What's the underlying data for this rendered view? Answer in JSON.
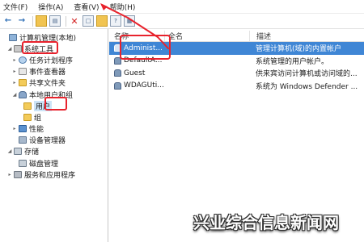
{
  "menu": {
    "items": [
      "文件(F)",
      "操作(A)",
      "查看(V)",
      "帮助(H)"
    ]
  },
  "tree": {
    "rows": [
      {
        "label": "计算机管理(本地)",
        "icon": "computer-icon"
      },
      {
        "label": "系统工具",
        "icon": "tools-icon"
      },
      {
        "label": "任务计划程序",
        "icon": "clock-icon"
      },
      {
        "label": "事件查看器",
        "icon": "event-log-icon"
      },
      {
        "label": "共享文件夹",
        "icon": "shared-folder-icon"
      },
      {
        "label": "本地用户和组",
        "icon": "users-icon"
      },
      {
        "label": "用户",
        "icon": "folder-icon"
      },
      {
        "label": "组",
        "icon": "folder-icon"
      },
      {
        "label": "性能",
        "icon": "performance-icon"
      },
      {
        "label": "设备管理器",
        "icon": "device-manager-icon"
      },
      {
        "label": "存储",
        "icon": "storage-icon"
      },
      {
        "label": "磁盘管理",
        "icon": "disk-icon"
      },
      {
        "label": "服务和应用程序",
        "icon": "services-icon"
      }
    ],
    "selected": "用户"
  },
  "list": {
    "headers": {
      "name": "名称",
      "full": "全名",
      "desc": "描述"
    },
    "rows": [
      {
        "name": "Administ...",
        "full": "",
        "desc": "管理计算机(域)的内置帐户"
      },
      {
        "name": "DefaultA...",
        "full": "",
        "desc": "系统管理的用户帐户。"
      },
      {
        "name": "Guest",
        "full": "",
        "desc": "供来宾访问计算机或访问域的..."
      },
      {
        "name": "WDAGUti...",
        "full": "",
        "desc": "系统为 Windows Defender ..."
      }
    ],
    "selected_index": 0
  },
  "colors": {
    "highlight_box": "#e8232d",
    "selected_row": "#3f86d5",
    "tree_selected": "#cce4f7"
  },
  "watermark": "兴业综合信息新闻网"
}
